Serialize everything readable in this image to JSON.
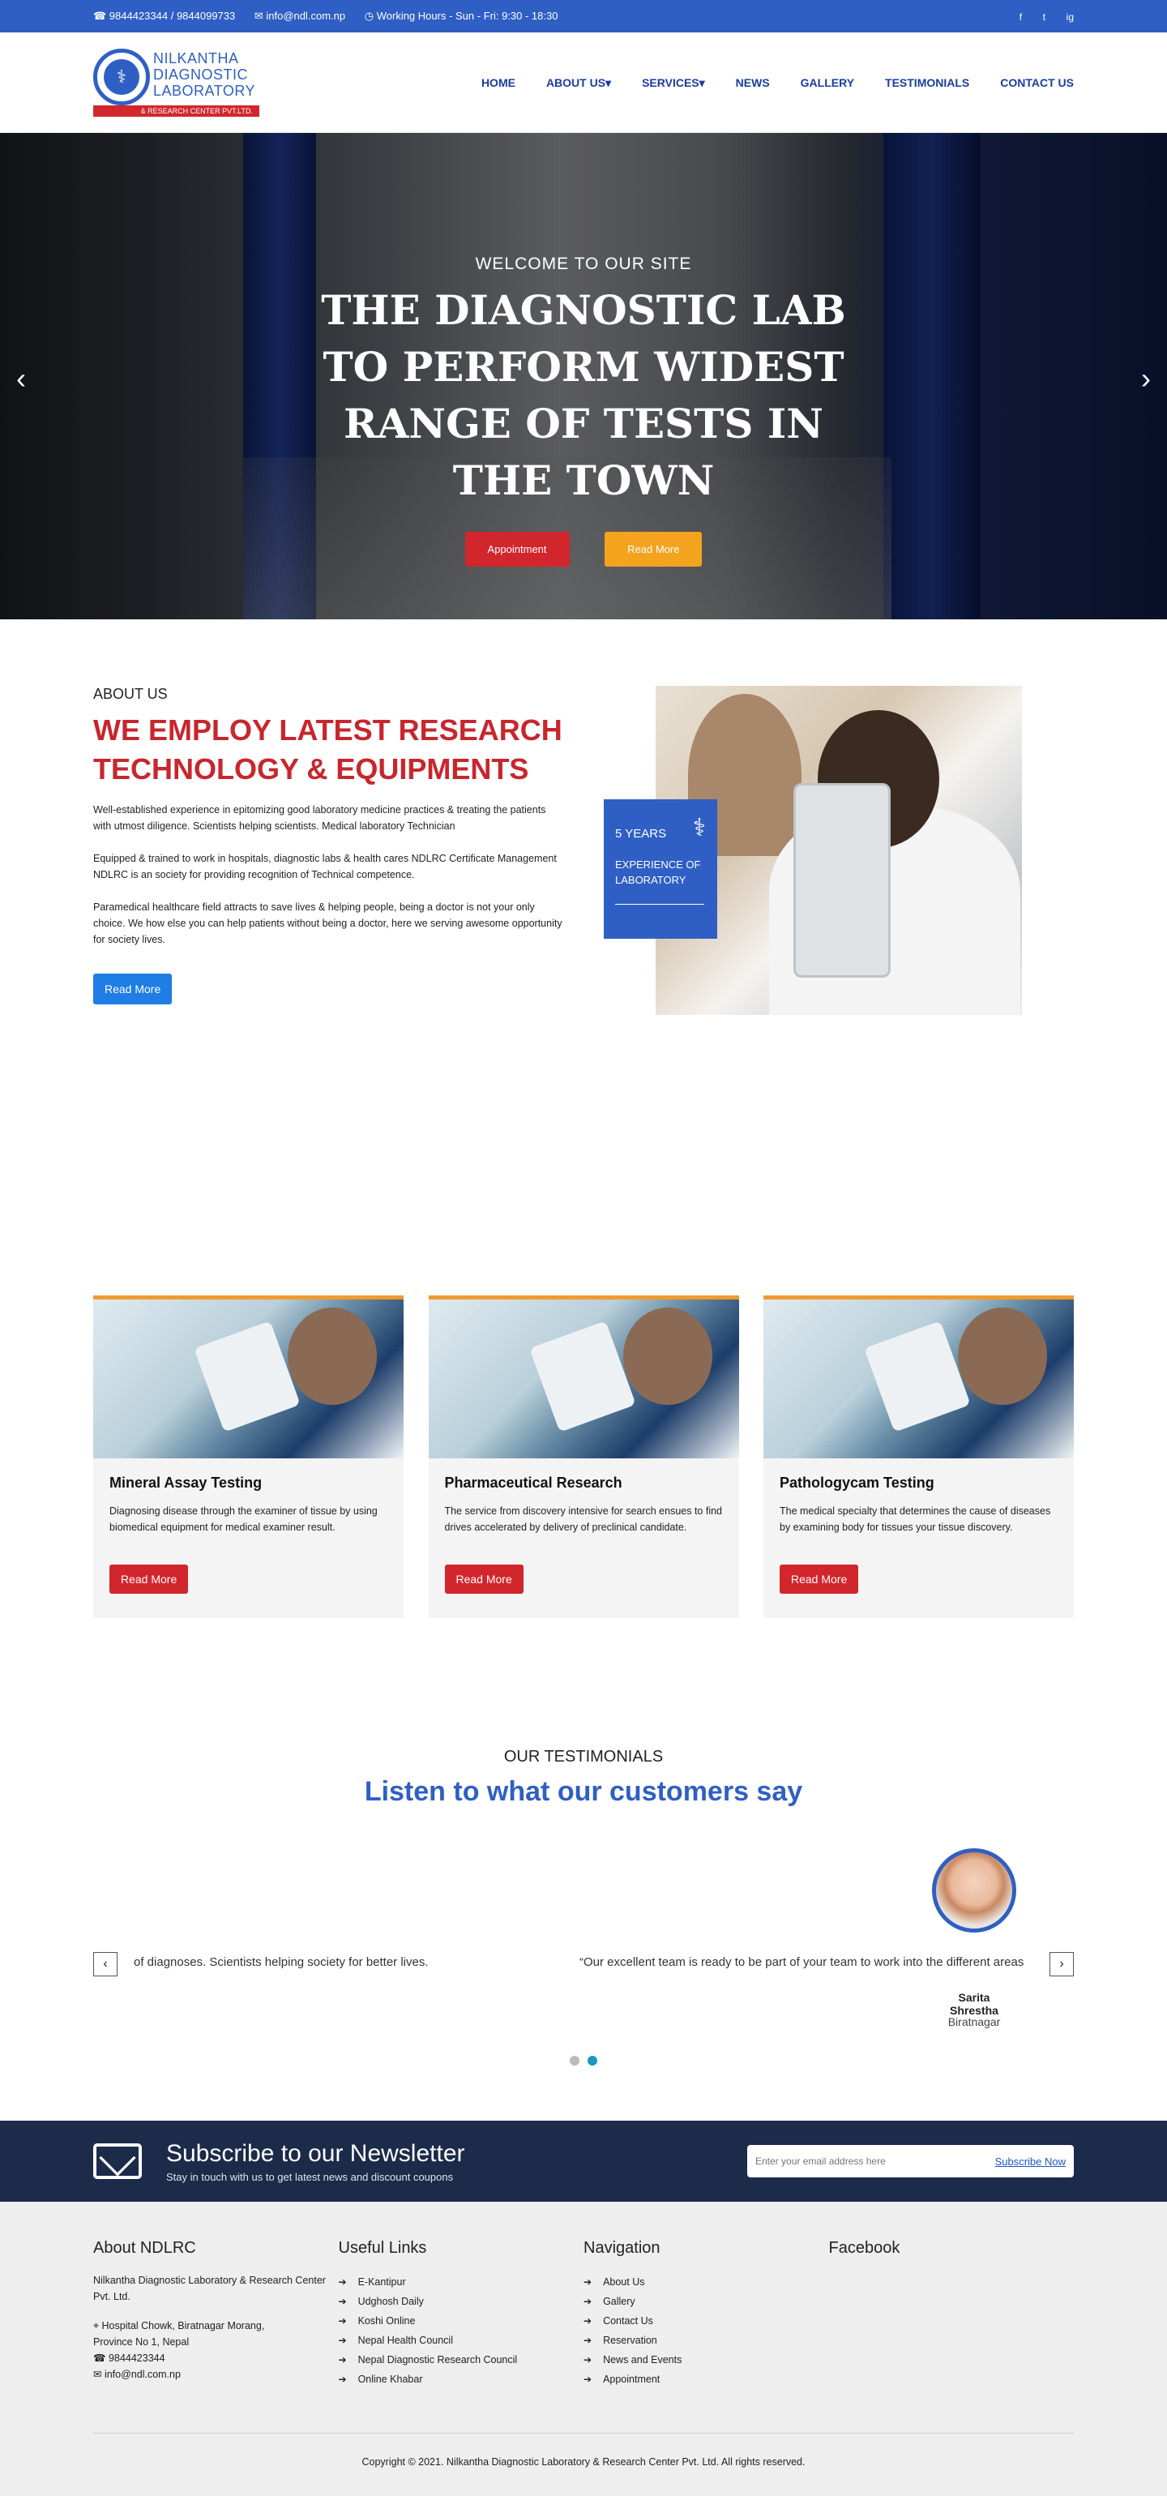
{
  "topbar": {
    "phone": "☎ 9844423344 / 9844099733",
    "email": "✉ info@ndl.com.np",
    "hours": "◷ Working Hours - Sun - Fri: 9:30 - 18:30",
    "social": [
      "f",
      "t",
      "ig"
    ]
  },
  "logo": {
    "line1": "NILKANTHA",
    "line2": "DIAGNOSTIC",
    "line3": "LABORATORY",
    "bar": "& RESEARCH CENTER PVT.LTD."
  },
  "nav": {
    "home": "HOME",
    "about": "ABOUT US▾",
    "services": "SERVICES▾",
    "news": "NEWS",
    "gallery": "GALLERY",
    "testimonials": "TESTIMONIALS",
    "contact": "CONTACT US"
  },
  "hero": {
    "welcome": "WELCOME TO OUR SITE",
    "title": "THE DIAGNOSTIC LAB TO PERFORM WIDEST RANGE OF TESTS IN THE TOWN",
    "btn_appointment": "Appointment",
    "btn_read": "Read More",
    "prev": "‹",
    "next": "›"
  },
  "about": {
    "kicker": "ABOUT US",
    "title": "WE EMPLOY LATEST RESEARCH TECHNOLOGY & EQUIPMENTS",
    "p1": "Well-established experience in epitomizing good laboratory medicine practices & treating the patients with utmost diligence. Scientists helping scientists. Medical laboratory Technician",
    "p2": "Equipped & trained to work in hospitals, diagnostic labs & health cares NDLRC Certificate Management NDLRC is an society for providing recognition of Technical competence.",
    "p3": "Paramedical healthcare field attracts to save lives & helping people, being a doctor is not your only choice. We how else you can help patients without being a doctor, here we serving awesome opportunity for society lives.",
    "btn": "Read More",
    "exp_years": "5 YEARS",
    "exp_text": "EXPERIENCE OF LABORATORY"
  },
  "cards": [
    {
      "title": "Mineral Assay Testing",
      "text": "Diagnosing disease through the examiner of tissue by using biomedical equipment for medical examiner result.",
      "btn": "Read More"
    },
    {
      "title": "Pharmaceutical Research",
      "text": "The service from discovery intensive for search ensues to find drives accelerated by delivery of preclinical candidate.",
      "btn": "Read More"
    },
    {
      "title": "Pathologycam Testing",
      "text": "The medical specialty that determines the cause of diseases by examining body for tissues your tissue discovery.",
      "btn": "Read More"
    }
  ],
  "testimonials": {
    "kicker": "OUR TESTIMONIALS",
    "title": "Listen to what our customers say",
    "quote_left": "of diagnoses. Scientists helping society for better lives.",
    "quote_right": "“Our excellent team is ready to be part of your team to work into the different areas",
    "name": "Sarita Shrestha",
    "place": "Biratnagar",
    "prev": "‹",
    "next": "›"
  },
  "newsletter": {
    "title": "Subscribe to our Newsletter",
    "sub": "Stay in touch with us to get latest news and discount coupons",
    "placeholder": "Enter your email address here",
    "btn": "Subscribe Now"
  },
  "footer": {
    "about_title": "About NDLRC",
    "about_text": "Nilkantha Diagnostic Laboratory & Research Center Pvt. Ltd.",
    "address": "⌖ Hospital Chowk, Biratnagar Morang, Province No 1, Nepal",
    "phone": "☎ 9844423344",
    "email": "✉ info@ndl.com.np",
    "useful_title": "Useful Links",
    "useful": [
      "E-Kantipur",
      "Udghosh Daily",
      "Koshi Online",
      "Nepal Health Council",
      "Nepal Diagnostic Research Council",
      "Online Khabar"
    ],
    "nav_title": "Navigation",
    "nav": [
      "About Us",
      "Gallery",
      "Contact Us",
      "Reservation",
      "News and Events",
      "Appointment"
    ],
    "fb_title": "Facebook",
    "copyright": "Copyright © 2021. Nilkantha Diagnostic Laboratory & Research Center Pvt. Ltd. All rights reserved."
  },
  "colors": {
    "primary": "#2f5fc4",
    "red": "#d2262d",
    "yellow": "#f4a31f",
    "navy": "#1c2b4a"
  }
}
